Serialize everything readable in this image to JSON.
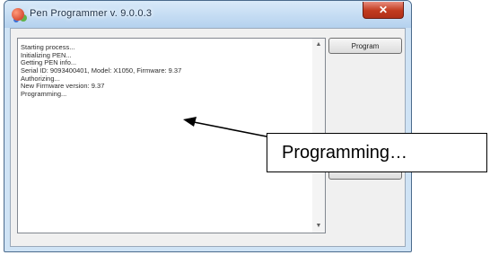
{
  "window": {
    "title": "Pen Programmer v. 9.0.0.3"
  },
  "log": {
    "lines": [
      "Starting process...",
      "Initializing PEN...",
      "Getting PEN info...",
      "Serial ID: 9093400401, Model: X1050, Firmware: 9.37",
      "Authorizing...",
      "New Firmware version: 9.37",
      "Programming..."
    ]
  },
  "buttons": {
    "program_label": "Program"
  },
  "callout": {
    "text": "Programming…"
  }
}
